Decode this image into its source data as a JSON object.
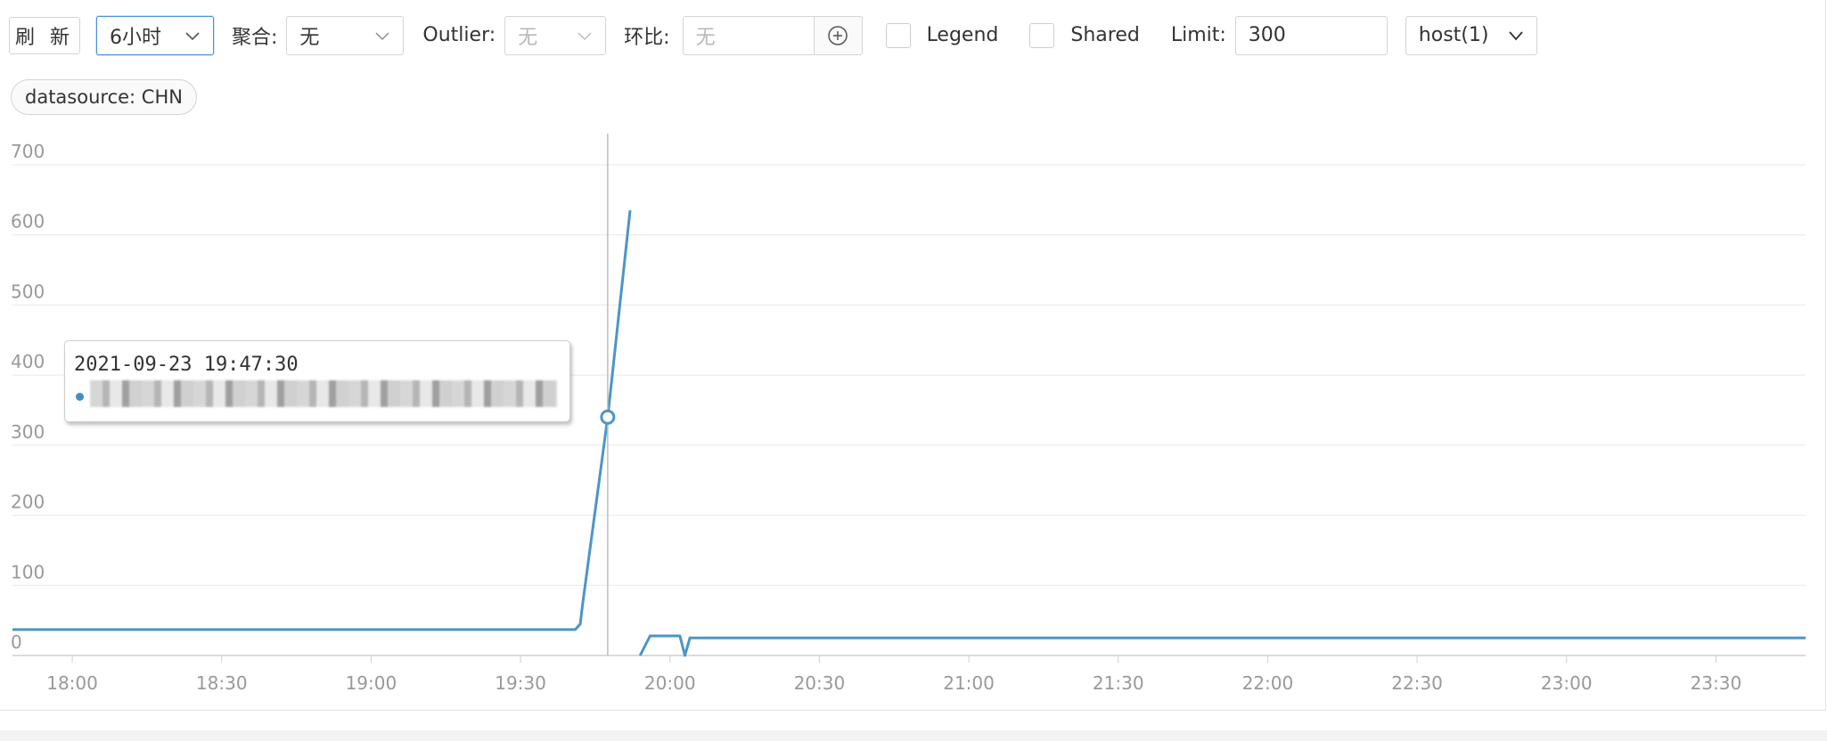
{
  "toolbar": {
    "refresh_label": "刷 新",
    "time_range": "6小时",
    "aggregate_label": "聚合:",
    "aggregate_value": "无",
    "outlier_label": "Outlier:",
    "outlier_value": "无",
    "compare_label": "环比:",
    "compare_placeholder": "无",
    "legend_label": "Legend",
    "shared_label": "Shared",
    "limit_label": "Limit:",
    "limit_value": "300",
    "host_select": "host(1)"
  },
  "tag": {
    "label": "datasource: CHN"
  },
  "tooltip": {
    "time": "2021-09-23 19:47:30"
  },
  "colors": {
    "series": "#4a96c8",
    "accent": "#4a90e2",
    "grid": "#e8e8e8"
  },
  "chart_data": {
    "type": "line",
    "x_ticks": [
      "18:00",
      "18:30",
      "19:00",
      "19:30",
      "20:00",
      "20:30",
      "21:00",
      "21:30",
      "22:00",
      "22:30",
      "23:00",
      "23:30"
    ],
    "y_ticks": [
      "0",
      "100",
      "200",
      "300",
      "400",
      "500",
      "600",
      "700"
    ],
    "ylim": [
      0,
      700
    ],
    "xlim": [
      "17:48",
      "23:48"
    ],
    "grid": true,
    "legend": "none",
    "series": [
      {
        "points": [
          [
            "17:48",
            37
          ],
          [
            "19:41",
            37
          ],
          [
            "19:42",
            45
          ],
          [
            "19:42:30",
            75
          ],
          [
            "19:47:30",
            340
          ],
          [
            "19:52",
            635
          ]
        ]
      },
      {
        "points": [
          [
            "19:54",
            0
          ],
          [
            "19:56",
            28
          ],
          [
            "20:02",
            28
          ],
          [
            "20:03",
            0
          ],
          [
            "20:04",
            25
          ],
          [
            "23:48",
            25
          ]
        ]
      }
    ],
    "hover": {
      "time": "19:47:30",
      "value": 340
    }
  }
}
